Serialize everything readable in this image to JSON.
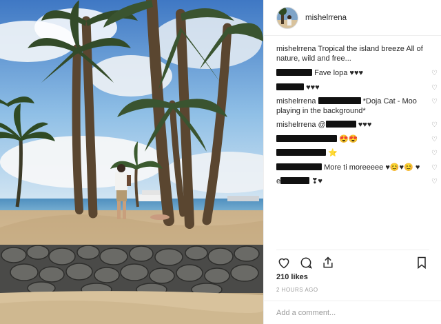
{
  "post": {
    "username": "mishelrrena",
    "caption_user": "mishelrrena",
    "caption_text": "Tropical the island breeze All of nature, wild and free...",
    "comments": [
      {
        "user_redacted": true,
        "text": "Fave lopa ♥♥♥"
      },
      {
        "user_redacted": true,
        "text": "♥♥♥"
      },
      {
        "user": "mishelrrena",
        "mention_redacted": true,
        "text": "*Doja Cat - Moo playing in the background*"
      },
      {
        "user": "mishelrrena",
        "mention_prefix": "@",
        "mention_redacted": true,
        "text": "♥♥♥"
      },
      {
        "user_redacted": true,
        "text": "😍😍"
      },
      {
        "user_redacted": true,
        "text": "⭐"
      },
      {
        "user_redacted": true,
        "text": "More ti moreeeee ♥😊♥😊 ♥"
      },
      {
        "user_prefix": "e",
        "user_redacted": true,
        "text": "❣♥"
      }
    ],
    "likes": "210 likes",
    "timestamp": "2 HOURS AGO",
    "add_comment_placeholder": "Add a comment..."
  },
  "icons": {
    "like": "heart-outline-icon",
    "comment": "speech-bubble-icon",
    "share": "share-icon",
    "save": "bookmark-icon",
    "comment_like": "small-heart-icon"
  },
  "colors": {
    "text": "#262626",
    "secondary": "#999999",
    "divider": "#efefef",
    "sky": "#6fa6dc",
    "sand": "#d9c4a0"
  }
}
